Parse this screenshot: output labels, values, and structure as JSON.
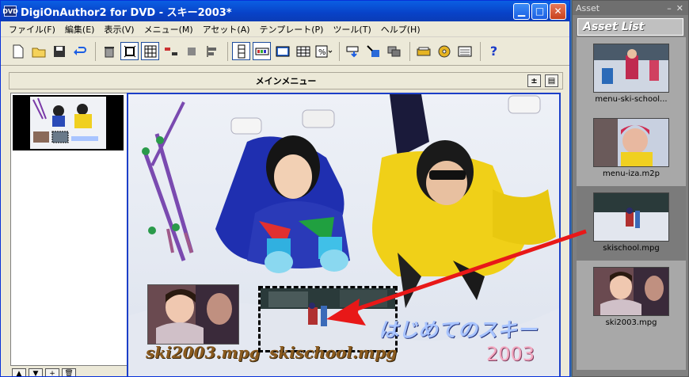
{
  "window": {
    "title": "DigiOnAuthor2 for DVD - スキー2003*",
    "icon_label": "DVD",
    "minimize_icon": "minimize-icon",
    "maximize_icon": "maximize-icon",
    "close_icon": "close-icon"
  },
  "menubar": {
    "items": [
      "ファイル(F)",
      "編集(E)",
      "表示(V)",
      "メニュー(M)",
      "アセット(A)",
      "テンプレート(P)",
      "ツール(T)",
      "ヘルプ(H)"
    ]
  },
  "toolbar": {
    "icons": [
      "new-document-icon",
      "open-folder-icon",
      "save-disk-icon",
      "undo-icon",
      "delete-trash-icon",
      "fit-frame-icon",
      "grid-icon",
      "align-icon",
      "group-icon",
      "align-left-icon",
      "panel-vertical-icon",
      "panel-horizontal-icon",
      "display-single-icon",
      "display-grid-icon",
      "percent-icon",
      "link-icon",
      "import-icon",
      "layers-icon",
      "burn-icon",
      "disc-icon",
      "settings-icon",
      "help-icon"
    ]
  },
  "editor": {
    "header_title": "メインメニュー",
    "left_buttons": [
      "▲",
      "▼",
      "+",
      "🗑"
    ]
  },
  "menu_canvas": {
    "buttons": [
      {
        "label": "ski2003.mpg"
      },
      {
        "label": "skischool.mpg"
      }
    ],
    "title_text": "はじめてのスキー",
    "year_text": "2003"
  },
  "asset_panel": {
    "window_label": "Asset",
    "header": "Asset List",
    "items": [
      {
        "name": "menu-ski-school...",
        "selected": false
      },
      {
        "name": "menu-iza.m2p",
        "selected": false
      },
      {
        "name": "skischool.mpg",
        "selected": true
      },
      {
        "name": "ski2003.mpg",
        "selected": false
      }
    ]
  },
  "colors": {
    "selection_border": "#1c3fc8",
    "arrow": "#e81818",
    "titlebar": "#0842c8"
  }
}
